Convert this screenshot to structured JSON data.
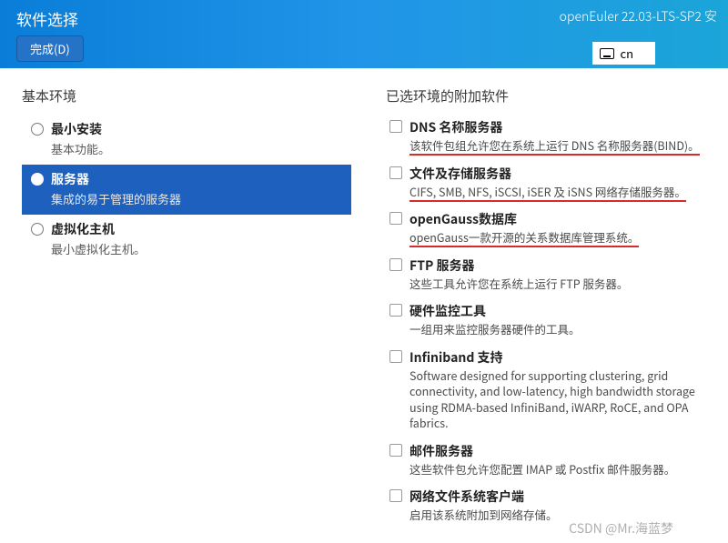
{
  "header": {
    "title": "软件选择",
    "done_label": "完成(D)",
    "distro": "openEuler 22.03-LTS-SP2 安",
    "lang_code": "cn"
  },
  "left": {
    "heading": "基本环境",
    "items": [
      {
        "label": "最小安装",
        "desc": "基本功能。"
      },
      {
        "label": "服务器",
        "desc": "集成的易于管理的服务器"
      },
      {
        "label": "虚拟化主机",
        "desc": "最小虚拟化主机。"
      }
    ],
    "selected_index": 1
  },
  "right": {
    "heading": "已选环境的附加软件",
    "items": [
      {
        "label": "DNS 名称服务器",
        "desc": "该软件包组允许您在系统上运行 DNS 名称服务器(BIND)。",
        "highlight": true
      },
      {
        "label": "文件及存储服务器",
        "desc": "CIFS, SMB, NFS, iSCSI, iSER 及 iSNS 网络存储服务器。",
        "highlight": true
      },
      {
        "label": "openGauss数据库",
        "desc": "openGauss一款开源的关系数据库管理系统。",
        "highlight": true
      },
      {
        "label": "FTP 服务器",
        "desc": "这些工具允许您在系统上运行 FTP 服务器。"
      },
      {
        "label": "硬件监控工具",
        "desc": "一组用来监控服务器硬件的工具。"
      },
      {
        "label": "Infiniband 支持",
        "desc": "Software designed for supporting clustering, grid connectivity, and low-latency, high bandwidth storage using RDMA-based InfiniBand, iWARP, RoCE, and OPA fabrics."
      },
      {
        "label": "邮件服务器",
        "desc": "这些软件包允许您配置 IMAP 或 Postfix 邮件服务器。"
      },
      {
        "label": "网络文件系统客户端",
        "desc": "启用该系统附加到网络存储。"
      }
    ]
  },
  "watermark": "CSDN @Mr.海蓝梦"
}
